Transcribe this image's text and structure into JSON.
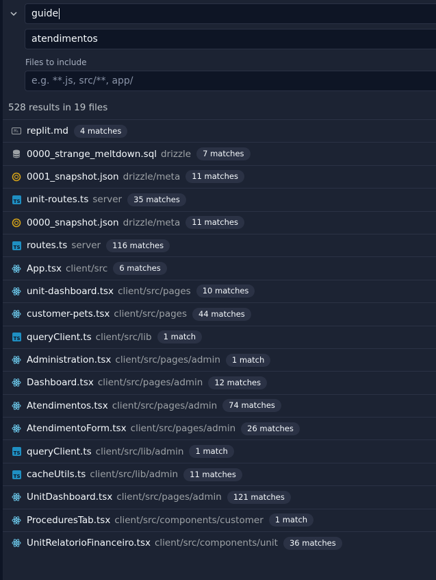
{
  "search": {
    "query": "guide",
    "replace": "atendimentos",
    "include_label": "Files to include",
    "include_placeholder": "e.g. **.js, src/**, app/"
  },
  "summary": "528 results in 19 files",
  "colors": {
    "background": "#1c2333",
    "field_bg": "#0e1525",
    "border": "#2b3245",
    "ts_blue": "#1f8fc2",
    "react_blue": "#6bc6e8",
    "json_yellow": "#d6a419"
  },
  "results": [
    {
      "icon": "markdown-icon",
      "name": "replit.md",
      "path": "",
      "matches": "4 matches"
    },
    {
      "icon": "database-icon",
      "name": "0000_strange_meltdown.sql",
      "path": "drizzle",
      "matches": "7 matches"
    },
    {
      "icon": "json-icon",
      "name": "0001_snapshot.json",
      "path": "drizzle/meta",
      "matches": "11 matches"
    },
    {
      "icon": "typescript-icon",
      "name": "unit-routes.ts",
      "path": "server",
      "matches": "35 matches"
    },
    {
      "icon": "json-icon",
      "name": "0000_snapshot.json",
      "path": "drizzle/meta",
      "matches": "11 matches"
    },
    {
      "icon": "typescript-icon",
      "name": "routes.ts",
      "path": "server",
      "matches": "116 matches"
    },
    {
      "icon": "react-icon",
      "name": "App.tsx",
      "path": "client/src",
      "matches": "6 matches"
    },
    {
      "icon": "react-icon",
      "name": "unit-dashboard.tsx",
      "path": "client/src/pages",
      "matches": "10 matches"
    },
    {
      "icon": "react-icon",
      "name": "customer-pets.tsx",
      "path": "client/src/pages",
      "matches": "44 matches"
    },
    {
      "icon": "typescript-icon",
      "name": "queryClient.ts",
      "path": "client/src/lib",
      "matches": "1 match"
    },
    {
      "icon": "react-icon",
      "name": "Administration.tsx",
      "path": "client/src/pages/admin",
      "matches": "1 match"
    },
    {
      "icon": "react-icon",
      "name": "Dashboard.tsx",
      "path": "client/src/pages/admin",
      "matches": "12 matches"
    },
    {
      "icon": "react-icon",
      "name": "Atendimentos.tsx",
      "path": "client/src/pages/admin",
      "matches": "74 matches"
    },
    {
      "icon": "react-icon",
      "name": "AtendimentoForm.tsx",
      "path": "client/src/pages/admin",
      "matches": "26 matches"
    },
    {
      "icon": "typescript-icon",
      "name": "queryClient.ts",
      "path": "client/src/lib/admin",
      "matches": "1 match"
    },
    {
      "icon": "typescript-icon",
      "name": "cacheUtils.ts",
      "path": "client/src/lib/admin",
      "matches": "11 matches"
    },
    {
      "icon": "react-icon",
      "name": "UnitDashboard.tsx",
      "path": "client/src/pages/admin",
      "matches": "121 matches"
    },
    {
      "icon": "react-icon",
      "name": "ProceduresTab.tsx",
      "path": "client/src/components/customer",
      "matches": "1 match"
    },
    {
      "icon": "react-icon",
      "name": "UnitRelatorioFinanceiro.tsx",
      "path": "client/src/components/unit",
      "matches": "36 matches"
    }
  ]
}
